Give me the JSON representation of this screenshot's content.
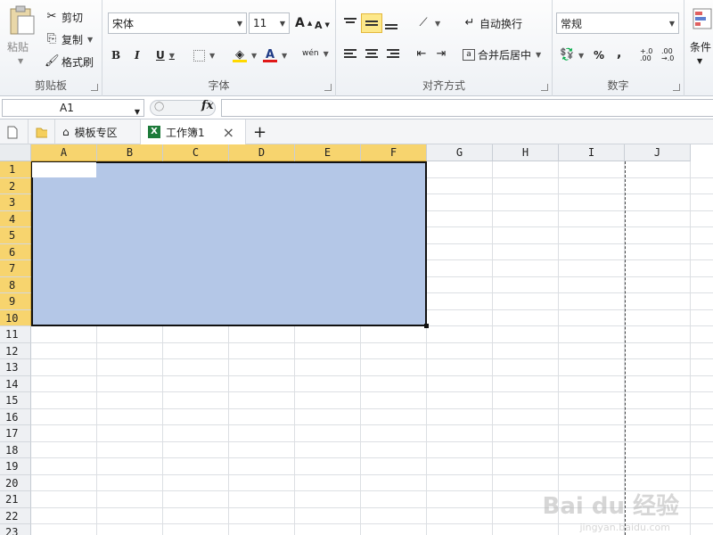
{
  "ribbon": {
    "clipboard": {
      "paste_label": "粘贴",
      "cut_label": "剪切",
      "copy_label": "复制",
      "format_painter_label": "格式刷",
      "group_label": "剪贴板"
    },
    "font": {
      "font_name": "宋体",
      "font_size": "11",
      "bold": "B",
      "italic": "I",
      "underline": "U",
      "grow": "A",
      "shrink": "A",
      "font_color_glyph": "A",
      "phonetic_glyph": "wén",
      "group_label": "字体"
    },
    "alignment": {
      "wrap_text_label": "自动换行",
      "merge_center_label": "合并后居中",
      "group_label": "对齐方式"
    },
    "number": {
      "format": "常规",
      "percent": "%",
      "comma": ",",
      "inc_decimal": "+.0 .00",
      "dec_decimal": ".00 →.0",
      "group_label": "数字"
    },
    "styles": {
      "conditional_label": "条件"
    }
  },
  "formula_bar": {
    "name_box": "A1",
    "fx_label": "fx",
    "value": ""
  },
  "tabs": {
    "templates_label": "模板专区",
    "workbook_label": "工作簿1",
    "close_glyph": "×",
    "add_glyph": "+"
  },
  "columns": [
    "A",
    "B",
    "C",
    "D",
    "E",
    "F",
    "G",
    "H",
    "I",
    "J"
  ],
  "rows": [
    "1",
    "2",
    "3",
    "4",
    "5",
    "6",
    "7",
    "8",
    "9",
    "10",
    "11",
    "12",
    "13",
    "14",
    "15",
    "16",
    "17",
    "18",
    "19",
    "20",
    "21",
    "22",
    "23"
  ],
  "selection": {
    "range": "A1:F10",
    "active_cell": "A1"
  },
  "watermark": {
    "main": "Bai du 经验",
    "sub": "jingyan.baidu.com"
  },
  "colors": {
    "selection_fill": "#b4c7e7",
    "header_selected": "#f7d46e",
    "accent": "#e3b73b"
  }
}
